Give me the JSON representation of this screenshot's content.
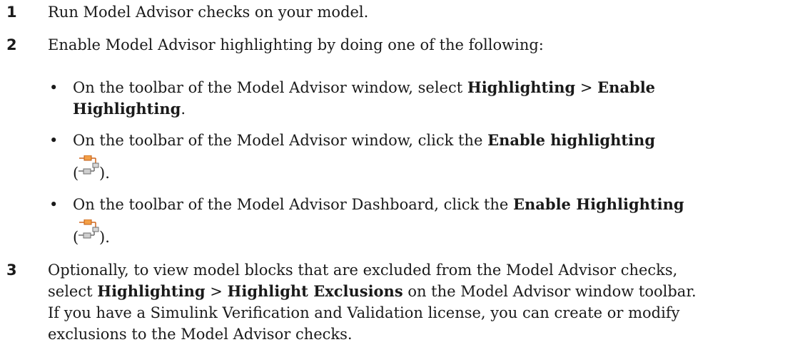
{
  "steps": [
    {
      "num": "1",
      "text": "Run Model Advisor checks on your model."
    },
    {
      "num": "2",
      "text": "Enable Model Advisor highlighting by doing one of the following:"
    },
    {
      "num": "3",
      "line1": "Optionally, to view model blocks that are excluded from the Model Advisor checks,",
      "line2_a": "select ",
      "line2_b1": "Highlighting",
      "line2_sep": " > ",
      "line2_b2": "Highlight Exclusions",
      "line2_c": " on the Model Advisor window toolbar.",
      "line3": "If you have a Simulink Verification and Validation license, you can create or modify",
      "line4": "exclusions to the Model Advisor checks."
    }
  ],
  "bullets": [
    {
      "dot": "•",
      "a": "On the toolbar of the Model Advisor window, select ",
      "b1": "Highlighting",
      "sep": " > ",
      "b2a": "Enable",
      "b2b": "Highlighting",
      "end": "."
    },
    {
      "dot": "•",
      "a": "On the toolbar of the Model Advisor window, click the ",
      "b": "Enable highlighting",
      "open": "(",
      "close": ").",
      "icon": "enable-highlighting-icon"
    },
    {
      "dot": "•",
      "a": "On the toolbar of the Model Advisor Dashboard, click the ",
      "b": "Enable Highlighting",
      "open": "(",
      "close": ").",
      "icon": "enable-highlighting-icon"
    }
  ],
  "colors": {
    "icon_orange": "#e8731a",
    "icon_gray": "#8a8a8a"
  }
}
